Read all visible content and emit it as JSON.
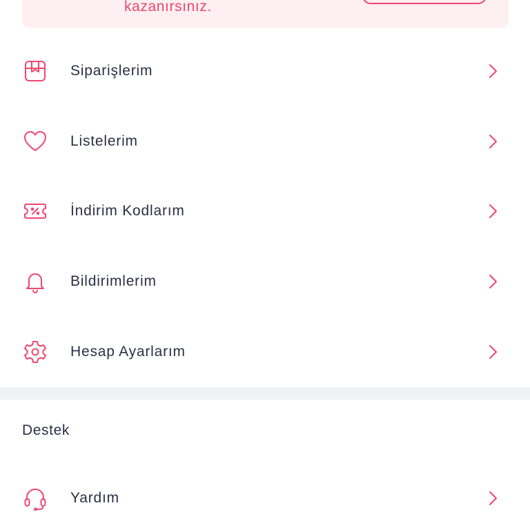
{
  "promo": {
    "text": "kazanırsınız.",
    "accent_color": "#f0466f",
    "background_color": "#fdeff2"
  },
  "menu": {
    "items": [
      {
        "label": "Siparişlerim",
        "icon": "package-icon"
      },
      {
        "label": "Listelerim",
        "icon": "heart-icon"
      },
      {
        "label": "İndirim Kodlarım",
        "icon": "coupon-icon"
      },
      {
        "label": "Bildirimlerim",
        "icon": "bell-icon"
      },
      {
        "label": "Hesap Ayarlarım",
        "icon": "gear-icon"
      }
    ]
  },
  "support": {
    "section_title": "Destek",
    "items": [
      {
        "label": "Yardım",
        "icon": "headset-icon"
      }
    ]
  },
  "colors": {
    "accent": "#f0466f",
    "text": "#2b2f45",
    "divider": "#f1f2f4"
  }
}
